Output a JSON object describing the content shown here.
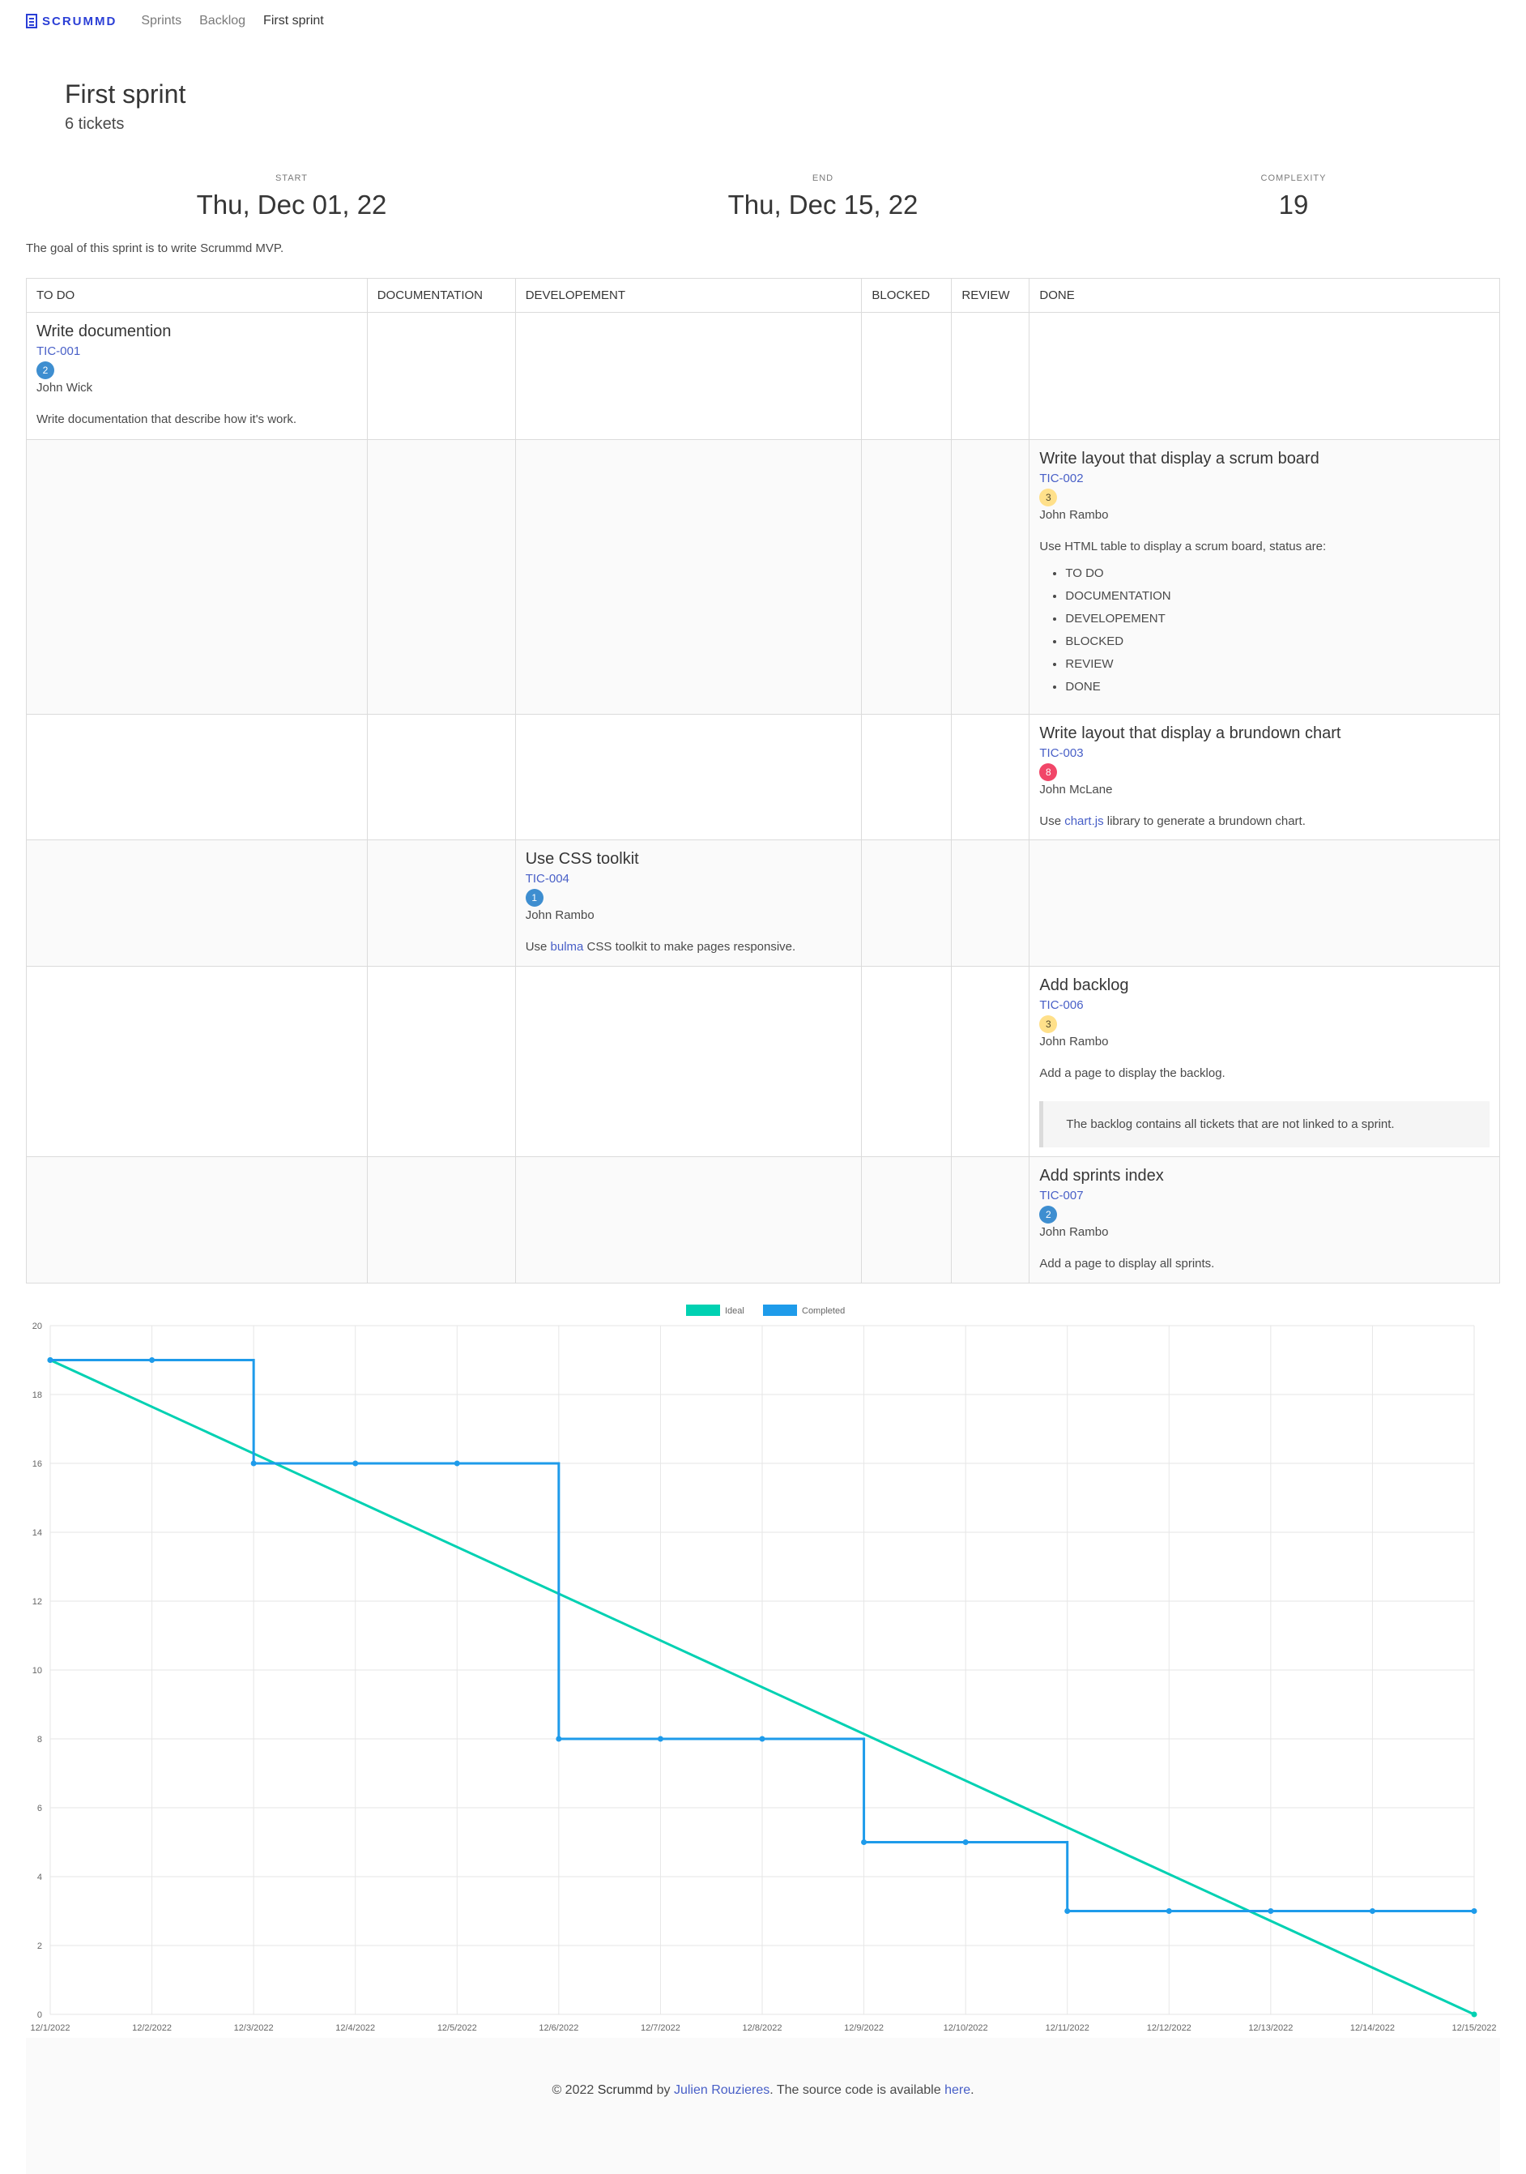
{
  "nav": {
    "brand": "SCRUMMD",
    "items": [
      "Sprints",
      "Backlog",
      "First sprint"
    ]
  },
  "header": {
    "title": "First sprint",
    "subtitle": "6 tickets"
  },
  "stats": {
    "start_label": "START",
    "start_value": "Thu, Dec 01, 22",
    "end_label": "END",
    "end_value": "Thu, Dec 15, 22",
    "complexity_label": "COMPLEXITY",
    "complexity_value": "19"
  },
  "goal": "The goal of this sprint is to write Scrummd MVP.",
  "board": {
    "columns": [
      "TO DO",
      "DOCUMENTATION",
      "DEVELOPEMENT",
      "BLOCKED",
      "REVIEW",
      "DONE"
    ],
    "tickets": [
      {
        "title": "Write documention",
        "id": "TIC-001",
        "points": "2",
        "assignee": "John Wick",
        "desc": "Write documentation that describe how it's work."
      },
      {
        "title": "Write layout that display a scrum board",
        "id": "TIC-002",
        "points": "3",
        "assignee": "John Rambo",
        "desc": "Use HTML table to display a scrum board, status are:",
        "list": [
          "TO DO",
          "DOCUMENTATION",
          "DEVELOPEMENT",
          "BLOCKED",
          "REVIEW",
          "DONE"
        ]
      },
      {
        "title": "Write layout that display a brundown chart",
        "id": "TIC-003",
        "points": "8",
        "assignee": "John McLane",
        "desc_pre": "Use ",
        "desc_link": "chart.js",
        "desc_post": " library to generate a brundown chart."
      },
      {
        "title": "Use CSS toolkit",
        "id": "TIC-004",
        "points": "1",
        "assignee": "John Rambo",
        "desc_pre": "Use ",
        "desc_link": "bulma",
        "desc_post": " CSS toolkit to make pages responsive."
      },
      {
        "title": "Add backlog",
        "id": "TIC-006",
        "points": "3",
        "assignee": "John Rambo",
        "desc": "Add a page to display the backlog.",
        "quote": "The backlog contains all tickets that are not linked to a sprint."
      },
      {
        "title": "Add sprints index",
        "id": "TIC-007",
        "points": "2",
        "assignee": "John Rambo",
        "desc": "Add a page to display all sprints."
      }
    ]
  },
  "chart_data": {
    "type": "line",
    "x": [
      "12/1/2022",
      "12/2/2022",
      "12/3/2022",
      "12/4/2022",
      "12/5/2022",
      "12/6/2022",
      "12/7/2022",
      "12/8/2022",
      "12/9/2022",
      "12/10/2022",
      "12/11/2022",
      "12/12/2022",
      "12/13/2022",
      "12/14/2022",
      "12/15/2022"
    ],
    "series": [
      {
        "name": "Ideal",
        "color": "#00d1b2",
        "values": [
          19,
          0
        ],
        "x_index": [
          0,
          14
        ]
      },
      {
        "name": "Completed",
        "color": "#1e9bea",
        "stepped": true,
        "values": [
          19,
          19,
          16,
          16,
          16,
          8,
          8,
          8,
          5,
          5,
          3,
          3,
          3,
          3,
          3
        ]
      }
    ],
    "ylim": [
      0,
      20
    ],
    "yticks": [
      "0",
      "2",
      "4",
      "6",
      "8",
      "10",
      "12",
      "14",
      "16",
      "18",
      "20"
    ],
    "legend": "top",
    "grid": true
  },
  "footer": {
    "pre": "© 2022 ",
    "brand": "Scrummd",
    "by": " by ",
    "author": "Julien Rouzieres",
    "mid": ". The source code is available ",
    "link": "here",
    "end": "."
  }
}
